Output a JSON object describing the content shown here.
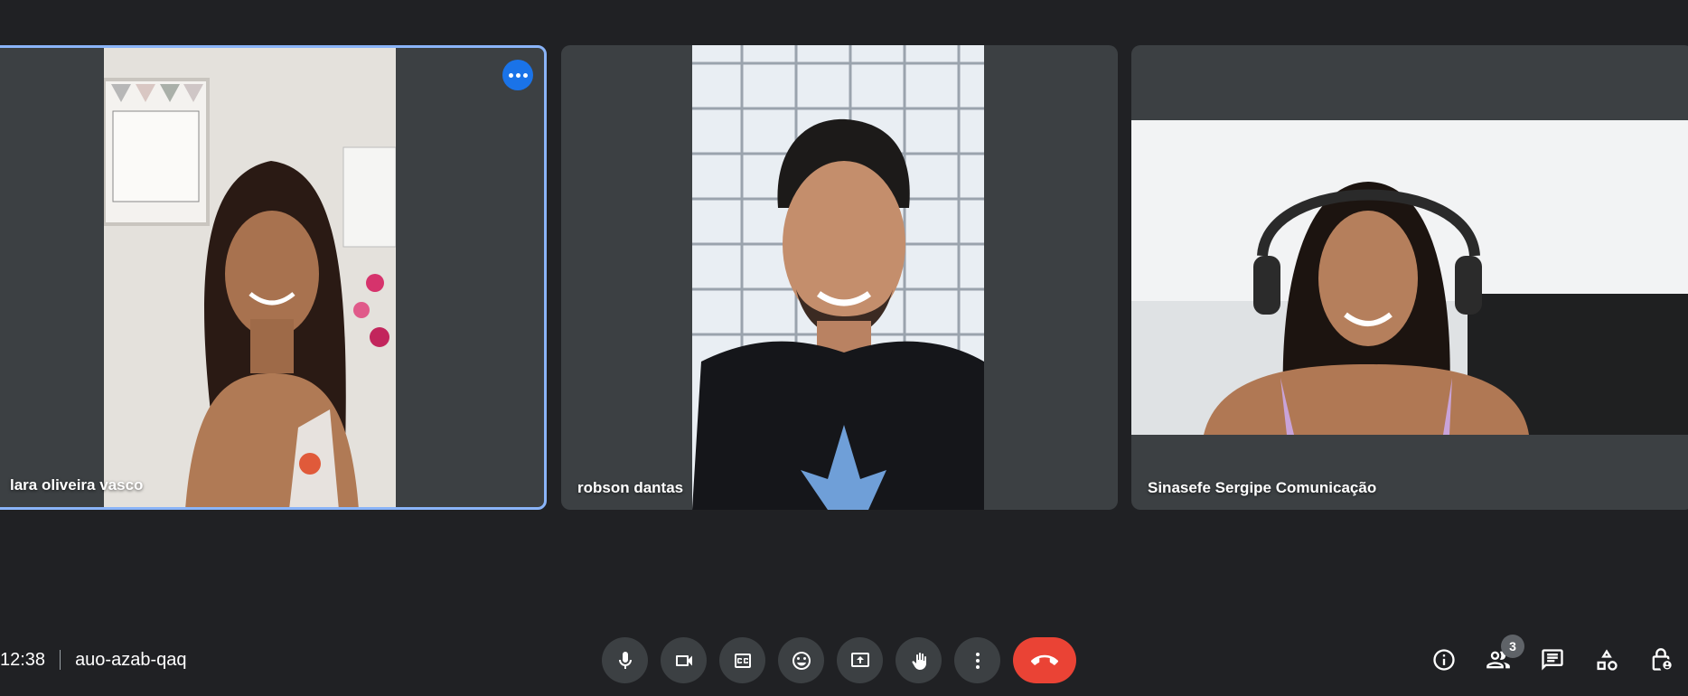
{
  "participants": [
    {
      "name": "lara oliveira vasco",
      "active": true
    },
    {
      "name": "robson dantas",
      "active": false
    },
    {
      "name": "Sinasefe Sergipe Comunicação",
      "active": false
    }
  ],
  "meeting": {
    "time": "12:38",
    "code": "auo-azab-qaq"
  },
  "controls": [
    "microphone-icon",
    "camera-icon",
    "captions-icon",
    "emoji-icon",
    "present-icon",
    "raise-hand-icon",
    "more-options-icon",
    "end-call-icon"
  ],
  "tools": {
    "people_count": "3"
  },
  "colors": {
    "background": "#202124",
    "tile": "#3c4043",
    "accent": "#8ab4f8",
    "end_call": "#ea4335",
    "more_button": "#1a73e8"
  }
}
